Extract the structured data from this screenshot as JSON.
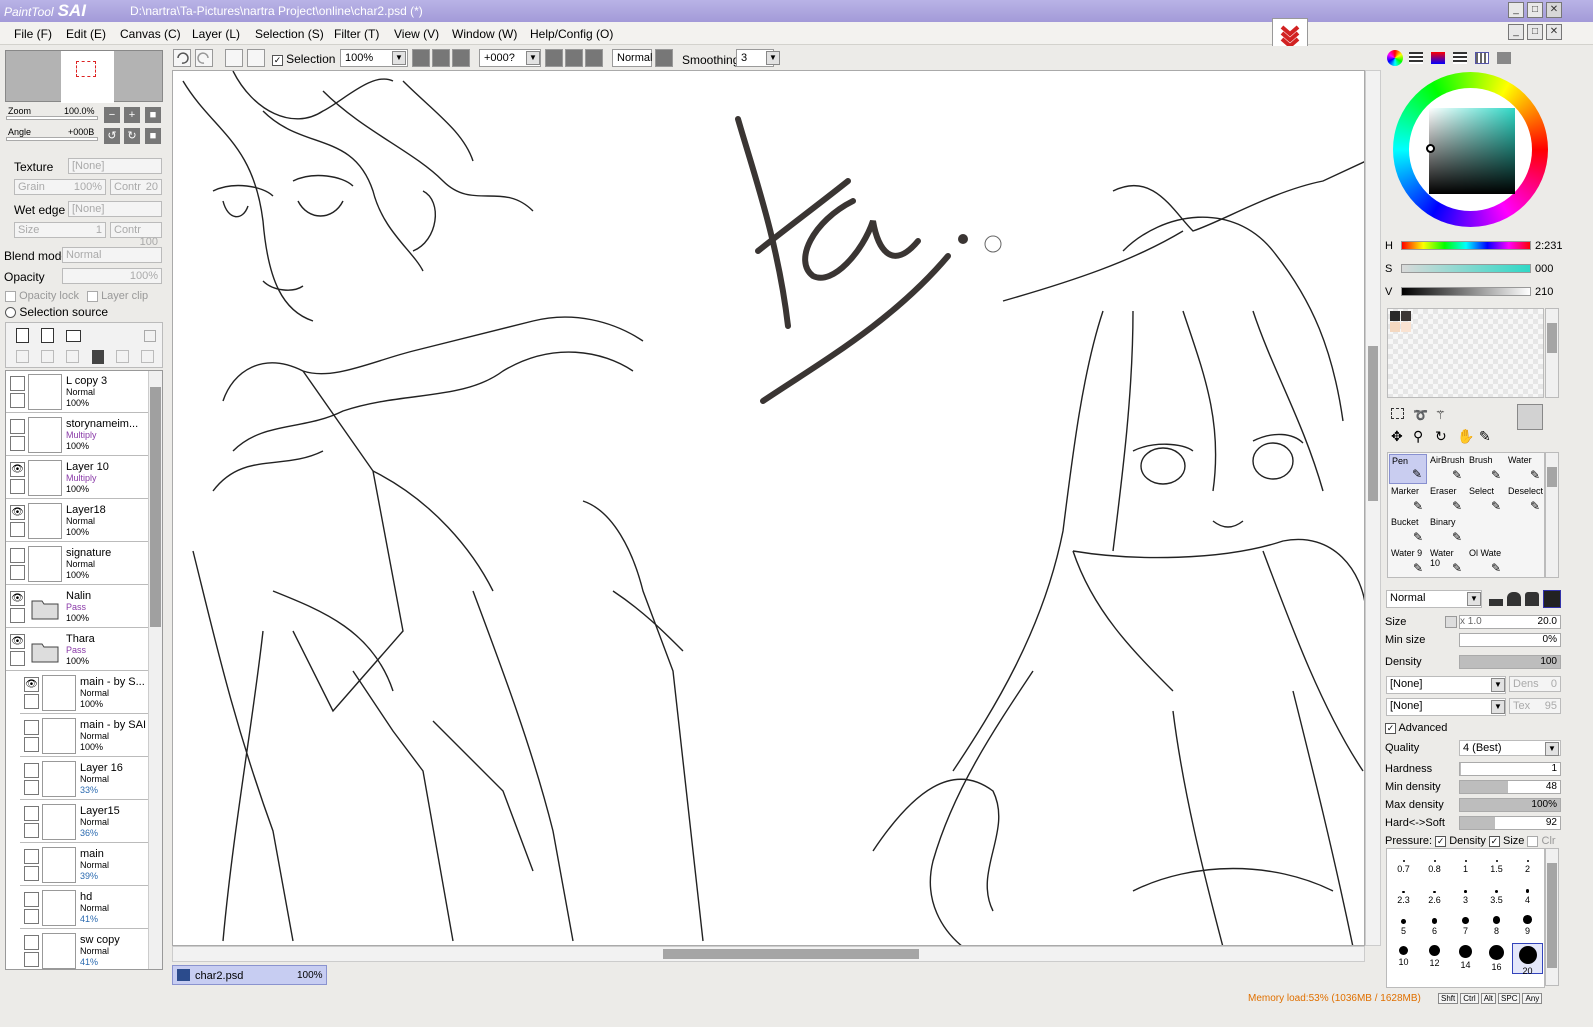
{
  "window": {
    "logo_small": "PaintTool",
    "logo_big": "SAI",
    "title": "D:\\nartra\\Ta-Pictures\\nartra Project\\online\\char2.psd (*)"
  },
  "menu": [
    "File (F)",
    "Edit (E)",
    "Canvas (C)",
    "Layer (L)",
    "Selection (S)",
    "Filter (T)",
    "View (V)",
    "Window (W)",
    "Help/Config (O)"
  ],
  "toolbar": {
    "selection_label": "Selection",
    "zoom": "100%",
    "angle": "+000?",
    "mode": "Normal",
    "smoothing_label": "Smoothing",
    "smoothing": "3"
  },
  "navigator": {
    "zoom_label": "Zoom",
    "zoom_value": "100.0%",
    "angle_label": "Angle",
    "angle_value": "+000B"
  },
  "texture": {
    "texture_label": "Texture",
    "texture_value": "[None]",
    "grain_label": "Grain",
    "grain_value": "100%",
    "contr_label": "Contr",
    "contr_value": "20",
    "wet_edge_label": "Wet edge",
    "wet_edge_value": "[None]",
    "size_label": "Size",
    "size_value": "1",
    "contr2_value": "100"
  },
  "blend": {
    "label": "Blend mode",
    "value": "Normal",
    "opacity_label": "Opacity",
    "opacity_value": "100%",
    "opacity_lock": "Opacity lock",
    "layer_clip": "Layer clip",
    "selection_source": "Selection source"
  },
  "layers": [
    {
      "name": "L copy 3",
      "mode": "Normal",
      "opacity": "100%",
      "visible": false,
      "folder": false,
      "sub": false
    },
    {
      "name": "storynameim...",
      "mode": "Multiply",
      "opacity": "100%",
      "visible": false,
      "folder": false,
      "sub": false
    },
    {
      "name": "Layer 10",
      "mode": "Multiply",
      "opacity": "100%",
      "visible": true,
      "folder": false,
      "sub": false
    },
    {
      "name": "Layer18",
      "mode": "Normal",
      "opacity": "100%",
      "visible": true,
      "folder": false,
      "sub": false
    },
    {
      "name": "signature",
      "mode": "Normal",
      "opacity": "100%",
      "visible": false,
      "folder": false,
      "sub": false
    },
    {
      "name": "Nalin",
      "mode": "Pass",
      "opacity": "100%",
      "visible": true,
      "folder": true,
      "sub": false
    },
    {
      "name": "Thara",
      "mode": "Pass",
      "opacity": "100%",
      "visible": true,
      "folder": true,
      "sub": false
    },
    {
      "name": "main - by S...",
      "mode": "Normal",
      "opacity": "100%",
      "visible": true,
      "folder": false,
      "sub": true
    },
    {
      "name": "main - by SAI",
      "mode": "Normal",
      "opacity": "100%",
      "visible": false,
      "folder": false,
      "sub": true
    },
    {
      "name": "Layer 16",
      "mode": "Normal",
      "opacity": "33%",
      "visible": false,
      "folder": false,
      "sub": true
    },
    {
      "name": "Layer15",
      "mode": "Normal",
      "opacity": "36%",
      "visible": false,
      "folder": false,
      "sub": true
    },
    {
      "name": "main",
      "mode": "Normal",
      "opacity": "39%",
      "visible": false,
      "folder": false,
      "sub": true
    },
    {
      "name": "hd",
      "mode": "Normal",
      "opacity": "41%",
      "visible": false,
      "folder": false,
      "sub": true
    },
    {
      "name": "sw copy",
      "mode": "Normal",
      "opacity": "41%",
      "visible": false,
      "folder": false,
      "sub": true
    }
  ],
  "tab": {
    "name": "char2.psd",
    "zoom": "100%"
  },
  "color": {
    "h_label": "H",
    "h_value": "2:231",
    "s_label": "S",
    "s_value": "000",
    "v_label": "V",
    "v_value": "210"
  },
  "tools": [
    [
      "Pen",
      "AirBrush",
      "Brush",
      "Water"
    ],
    [
      "Marker",
      "Eraser",
      "Select",
      "Deselect"
    ],
    [
      "Bucket",
      "Binary",
      "",
      ""
    ],
    [
      "Water 9",
      "Water 10",
      "Ol Wate",
      ""
    ]
  ],
  "brush_settings": {
    "mode": "Normal",
    "size_label": "Size",
    "size_mult": "x 1.0",
    "size_value": "20.0",
    "min_size_label": "Min size",
    "min_size_value": "0%",
    "density_label": "Density",
    "density_value": "100",
    "shape1": "[None]",
    "dens_label": "Dens",
    "dens_value": "0",
    "shape2": "[None]",
    "tex_label": "Tex",
    "tex_value": "95",
    "advanced_label": "Advanced",
    "quality_label": "Quality",
    "quality_value": "4 (Best)",
    "hardness_label": "Hardness",
    "hardness_value": "1",
    "min_density_label": "Min density",
    "min_density_value": "48",
    "max_density_label": "Max density",
    "max_density_value": "100%",
    "hardsoft_label": "Hard<->Soft",
    "hardsoft_value": "92",
    "pressure_label": "Pressure:",
    "pressure_density": "Density",
    "pressure_size": "Size",
    "pressure_clr": "Clr"
  },
  "brush_sizes": [
    "0.7",
    "0.8",
    "1",
    "1.5",
    "2",
    "2.3",
    "2.6",
    "3",
    "3.5",
    "4",
    "5",
    "6",
    "7",
    "8",
    "9",
    "10",
    "12",
    "14",
    "16",
    "20"
  ],
  "status": {
    "memory": "Memory load:53% (1036MB / 1628MB)",
    "keys": [
      "Shft",
      "Ctrl",
      "Alt",
      "SPC",
      "Any"
    ]
  },
  "colors": {
    "title_bar": "#a39ad8",
    "accent_red": "#d22222",
    "memory_text": "#e07000",
    "mode_purple": "#8a3aa8"
  }
}
